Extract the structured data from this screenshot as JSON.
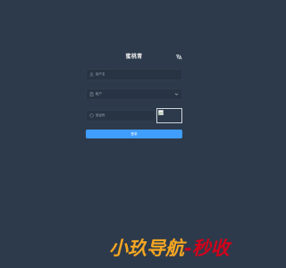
{
  "form": {
    "title": "蜜桃青",
    "username_placeholder": "用户名",
    "tenant_value": "租户",
    "captcha_placeholder": "验证码",
    "login_label": "登录"
  },
  "icons": {
    "lang": "language-icon",
    "user": "user-icon",
    "tenant": "building-icon",
    "captcha": "shield-icon",
    "chevron": "chevron-down-icon",
    "broken_image": "broken-image-icon"
  },
  "watermark": {
    "part1": "小玖导航",
    "part2": "-秒收"
  },
  "colors": {
    "background": "#2d3a4b",
    "button": "#409eff",
    "watermark_orange": "#f5a623",
    "watermark_red": "#d0021b"
  }
}
